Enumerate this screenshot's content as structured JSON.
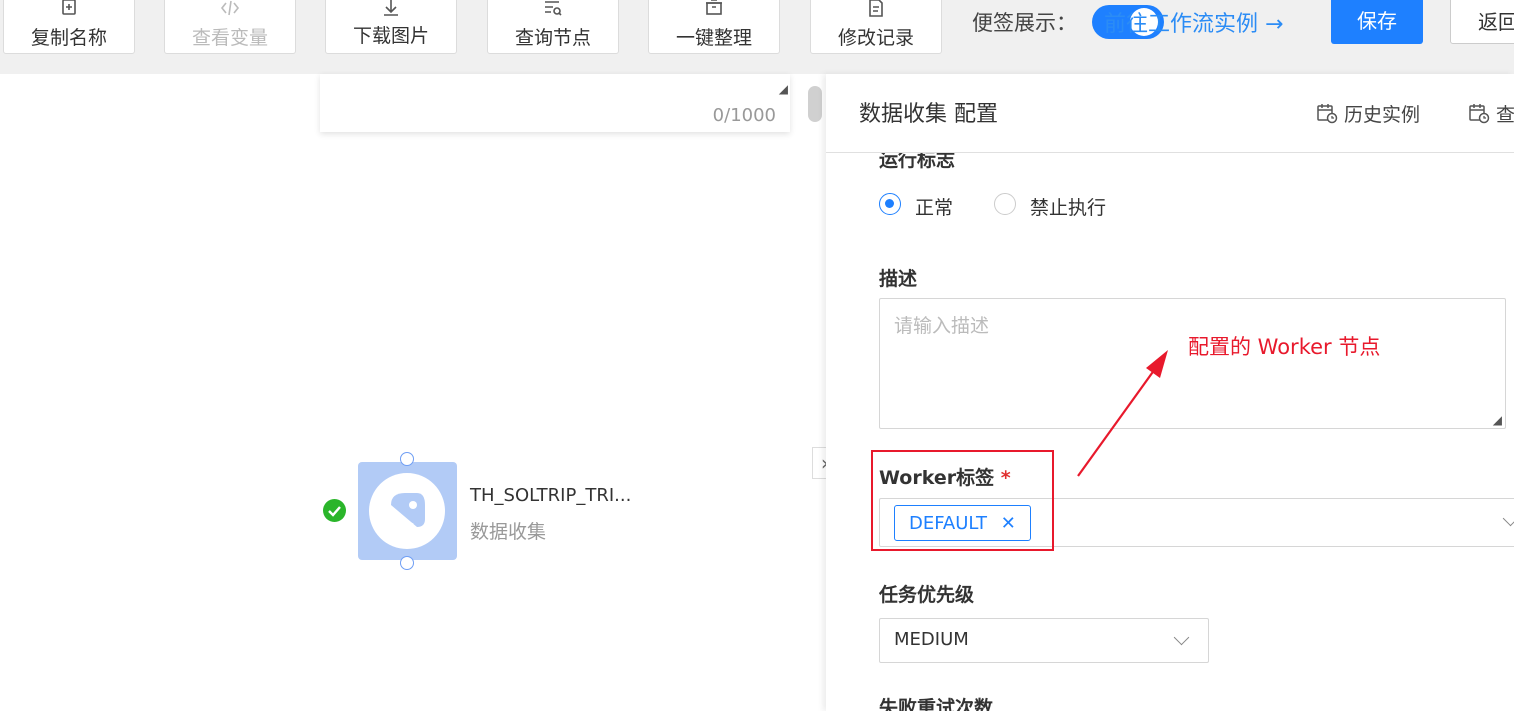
{
  "toolbar": {
    "buttons": [
      {
        "label": "复制名称",
        "icon": "copy-plus-icon"
      },
      {
        "label": "查看变量",
        "icon": "code-icon"
      },
      {
        "label": "下载图片",
        "icon": "download-icon"
      },
      {
        "label": "查询节点",
        "icon": "search-list-icon"
      },
      {
        "label": "一键整理",
        "icon": "archive-icon"
      },
      {
        "label": "修改记录",
        "icon": "edit-doc-icon"
      }
    ],
    "sticky_label": "便签展示：",
    "goto_link": "前往工作流实例 →",
    "save_label": "保存",
    "back_label": "返回"
  },
  "canvas": {
    "textarea_count": "0/1000",
    "node": {
      "name": "TH_SOLTRIP_TRI...",
      "type": "数据收集",
      "status": "success"
    }
  },
  "panel": {
    "title": "数据收集 配置",
    "history_label": "历史实例",
    "check_label": "查",
    "run_flag": {
      "label": "运行标志",
      "options": [
        "正常",
        "禁止执行"
      ],
      "selected": "正常"
    },
    "description": {
      "label": "描述",
      "placeholder": "请输入描述"
    },
    "worker": {
      "label": "Worker标签",
      "required_mark": "*",
      "tags": [
        "DEFAULT"
      ]
    },
    "priority": {
      "label": "任务优先级",
      "value": "MEDIUM"
    },
    "retry": {
      "label": "失败重试次数"
    }
  },
  "annotation": {
    "text": "配置的 Worker 节点",
    "color": "#e8192c"
  },
  "colors": {
    "primary": "#1e80ff",
    "success": "#2ab52a",
    "annotation": "#e8192c"
  }
}
